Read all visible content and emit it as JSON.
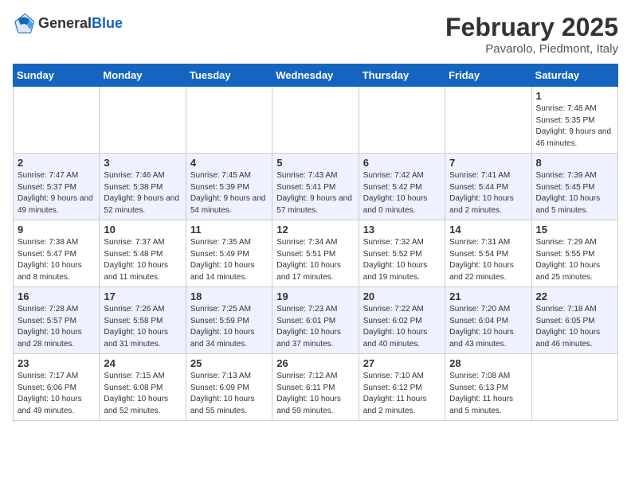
{
  "header": {
    "logo_general": "General",
    "logo_blue": "Blue",
    "month_title": "February 2025",
    "location": "Pavarolo, Piedmont, Italy"
  },
  "days_of_week": [
    "Sunday",
    "Monday",
    "Tuesday",
    "Wednesday",
    "Thursday",
    "Friday",
    "Saturday"
  ],
  "weeks": [
    [
      {
        "day": "",
        "info": ""
      },
      {
        "day": "",
        "info": ""
      },
      {
        "day": "",
        "info": ""
      },
      {
        "day": "",
        "info": ""
      },
      {
        "day": "",
        "info": ""
      },
      {
        "day": "",
        "info": ""
      },
      {
        "day": "1",
        "info": "Sunrise: 7:48 AM\nSunset: 5:35 PM\nDaylight: 9 hours and 46 minutes."
      }
    ],
    [
      {
        "day": "2",
        "info": "Sunrise: 7:47 AM\nSunset: 5:37 PM\nDaylight: 9 hours and 49 minutes."
      },
      {
        "day": "3",
        "info": "Sunrise: 7:46 AM\nSunset: 5:38 PM\nDaylight: 9 hours and 52 minutes."
      },
      {
        "day": "4",
        "info": "Sunrise: 7:45 AM\nSunset: 5:39 PM\nDaylight: 9 hours and 54 minutes."
      },
      {
        "day": "5",
        "info": "Sunrise: 7:43 AM\nSunset: 5:41 PM\nDaylight: 9 hours and 57 minutes."
      },
      {
        "day": "6",
        "info": "Sunrise: 7:42 AM\nSunset: 5:42 PM\nDaylight: 10 hours and 0 minutes."
      },
      {
        "day": "7",
        "info": "Sunrise: 7:41 AM\nSunset: 5:44 PM\nDaylight: 10 hours and 2 minutes."
      },
      {
        "day": "8",
        "info": "Sunrise: 7:39 AM\nSunset: 5:45 PM\nDaylight: 10 hours and 5 minutes."
      }
    ],
    [
      {
        "day": "9",
        "info": "Sunrise: 7:38 AM\nSunset: 5:47 PM\nDaylight: 10 hours and 8 minutes."
      },
      {
        "day": "10",
        "info": "Sunrise: 7:37 AM\nSunset: 5:48 PM\nDaylight: 10 hours and 11 minutes."
      },
      {
        "day": "11",
        "info": "Sunrise: 7:35 AM\nSunset: 5:49 PM\nDaylight: 10 hours and 14 minutes."
      },
      {
        "day": "12",
        "info": "Sunrise: 7:34 AM\nSunset: 5:51 PM\nDaylight: 10 hours and 17 minutes."
      },
      {
        "day": "13",
        "info": "Sunrise: 7:32 AM\nSunset: 5:52 PM\nDaylight: 10 hours and 19 minutes."
      },
      {
        "day": "14",
        "info": "Sunrise: 7:31 AM\nSunset: 5:54 PM\nDaylight: 10 hours and 22 minutes."
      },
      {
        "day": "15",
        "info": "Sunrise: 7:29 AM\nSunset: 5:55 PM\nDaylight: 10 hours and 25 minutes."
      }
    ],
    [
      {
        "day": "16",
        "info": "Sunrise: 7:28 AM\nSunset: 5:57 PM\nDaylight: 10 hours and 28 minutes."
      },
      {
        "day": "17",
        "info": "Sunrise: 7:26 AM\nSunset: 5:58 PM\nDaylight: 10 hours and 31 minutes."
      },
      {
        "day": "18",
        "info": "Sunrise: 7:25 AM\nSunset: 5:59 PM\nDaylight: 10 hours and 34 minutes."
      },
      {
        "day": "19",
        "info": "Sunrise: 7:23 AM\nSunset: 6:01 PM\nDaylight: 10 hours and 37 minutes."
      },
      {
        "day": "20",
        "info": "Sunrise: 7:22 AM\nSunset: 6:02 PM\nDaylight: 10 hours and 40 minutes."
      },
      {
        "day": "21",
        "info": "Sunrise: 7:20 AM\nSunset: 6:04 PM\nDaylight: 10 hours and 43 minutes."
      },
      {
        "day": "22",
        "info": "Sunrise: 7:18 AM\nSunset: 6:05 PM\nDaylight: 10 hours and 46 minutes."
      }
    ],
    [
      {
        "day": "23",
        "info": "Sunrise: 7:17 AM\nSunset: 6:06 PM\nDaylight: 10 hours and 49 minutes."
      },
      {
        "day": "24",
        "info": "Sunrise: 7:15 AM\nSunset: 6:08 PM\nDaylight: 10 hours and 52 minutes."
      },
      {
        "day": "25",
        "info": "Sunrise: 7:13 AM\nSunset: 6:09 PM\nDaylight: 10 hours and 55 minutes."
      },
      {
        "day": "26",
        "info": "Sunrise: 7:12 AM\nSunset: 6:11 PM\nDaylight: 10 hours and 59 minutes."
      },
      {
        "day": "27",
        "info": "Sunrise: 7:10 AM\nSunset: 6:12 PM\nDaylight: 11 hours and 2 minutes."
      },
      {
        "day": "28",
        "info": "Sunrise: 7:08 AM\nSunset: 6:13 PM\nDaylight: 11 hours and 5 minutes."
      },
      {
        "day": "",
        "info": ""
      }
    ]
  ]
}
